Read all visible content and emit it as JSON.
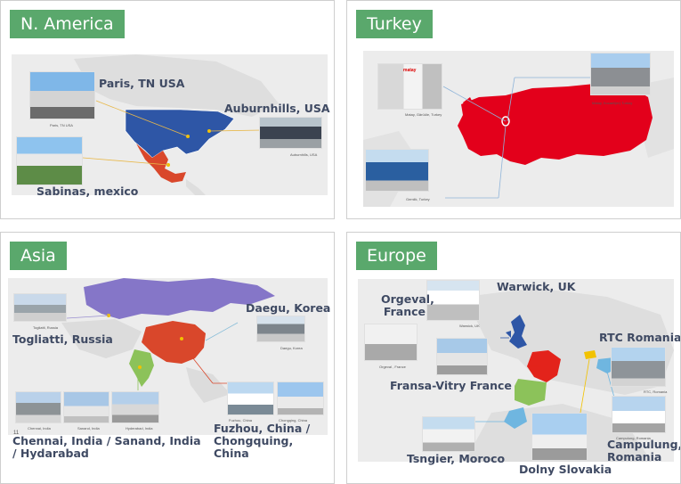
{
  "north_america": {
    "title": "N. America",
    "paris_label": "Paris, TN USA",
    "paris_caption": "Paris, TN USA",
    "auburn_label": "Auburnhills, USA",
    "auburn_caption": "Auburnhills, USA",
    "sabinas_label": "Sabinas, mexico"
  },
  "turkey": {
    "title": "Turkey",
    "caption_1": "Matay, Gärüüle, Turkey",
    "caption_2": "Matay, Kocaeli(er) Turkey",
    "caption_3": "Gemlik, Turkey",
    "sign_text": "matay"
  },
  "asia": {
    "title": "Asia",
    "daegu_label": "Daegu, Korea",
    "daegu_caption": "Daegu, Korea",
    "togliatti_label": "Togliatti, Russia",
    "togliatti_caption": "Togliatti, Russia",
    "india_label": "Chennai, India / Sanand, India / Hydarabad",
    "india_caption_1": "Chennai, India",
    "india_caption_2": "Sanand, India",
    "india_caption_3": "Hyderabad, India",
    "china_label": "Fuzhou, China / Chongquing, China",
    "china_caption_1": "Fuzhou, China",
    "china_caption_2": "Chongqing, China",
    "page_number": "11"
  },
  "europe": {
    "title": "Europe",
    "orgeval_label": "Orgeval, France",
    "orgeval_caption": "Orgeval , France",
    "warwick_label": "Warwick, UK",
    "warwick_caption": "Warwick, UK",
    "fransa_label": "Fransa-Vitry France",
    "rtc_label": "RTC Romania",
    "rtc_caption": "RTC, Romania",
    "campulung_label": "Campulung, Romania",
    "campulung_caption": "Campulung, Romania",
    "tangier_label": "Tsngier, Moroco",
    "dolny_label": "Dolny Slovakia"
  },
  "colors": {
    "accent_green": "#5aa86c",
    "usa_blue": "#2e56a6",
    "mexico_red": "#d9472b",
    "turkey_red": "#e3001b",
    "russia_purple": "#8576c8",
    "china_red": "#d9472b",
    "india_green": "#8cc25a"
  }
}
